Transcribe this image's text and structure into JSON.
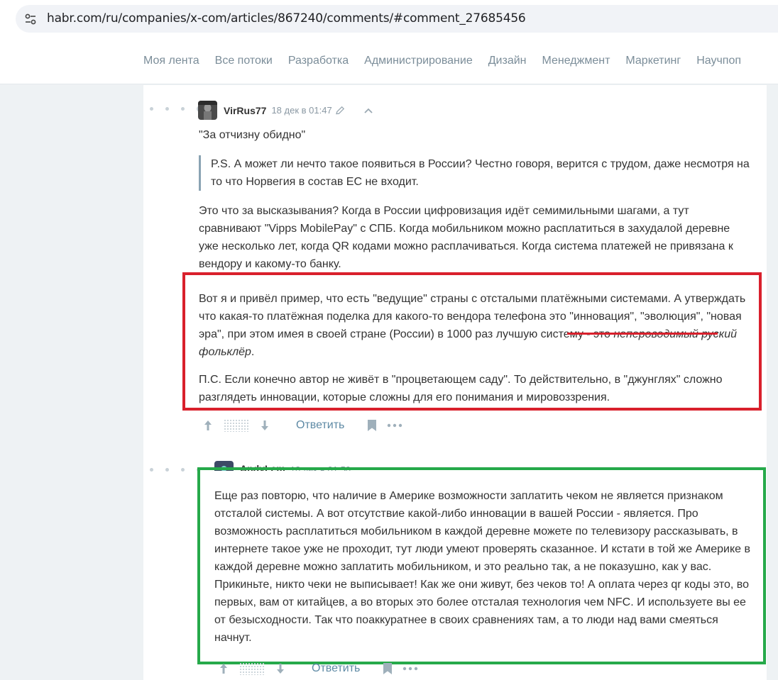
{
  "browser": {
    "url": "habr.com/ru/companies/x-com/articles/867240/comments/#comment_27685456"
  },
  "nav": {
    "items": [
      "Моя лента",
      "Все потоки",
      "Разработка",
      "Администрирование",
      "Дизайн",
      "Менеджмент",
      "Маркетинг",
      "Научпоп"
    ]
  },
  "comments": [
    {
      "author": "VirRus77",
      "date": "18 дек в 01:47",
      "intro": "\"За отчизну обидно\"",
      "quote": "P.S. А может ли нечто такое появиться в России? Честно говоря, верится с трудом, даже несмотря на то что Норвегия в состав ЕС не входит.",
      "p1": "Это что за высказывания? Когда в России цифровизация идёт семимильными шагами, а тут сравнивают \"Vipps MobilePay\" с СПБ. Когда мобильником можно расплатиться в захудалой деревне уже несколько лет, когда QR кодами можно расплачиваться. Когда система платежей не привязана к вендору и какому-то банку.",
      "p2_a": "Вот я и привёл пример, что есть \"ведущие\" страны с отсталыми платёжными системами. А утверждать что какая-то платёжная поделка для какого-то вендора телефона это \"инновация\", \"эволюция\", \"новая эра\", при этом имея в своей стране (России) в 1000 раз лучшую систему - это ",
      "p2_em": "непероводимый руский фольклёр",
      "p2_end": ".",
      "p3": "П.С. Если конечно автор не живёт в \"процветающем саду\". То действительно, в \"джунглях\" сложно разглядеть инновации, которые сложны для его понимания и мировоззрения.",
      "reply_label": "Ответить"
    },
    {
      "author": "AndyLem",
      "date": "18 дек в 01:50",
      "text": "Еще раз повторю, что наличие в Америке возможности заплатить чеком не является признаком отсталой системы. А вот отсутствие какой-либо инновации в вашей России - является. Про возможность расплатиться мобильником в каждой деревне можете по телевизору рассказывать, в интернете такое уже не проходит, тут люди умеют проверять сказанное. И кстати в той же Америке в каждой деревне можно заплатить мобильником, и это реально так, а не показушно, как у вас. Прикиньте, никто чеки не выписывает! Как же они живут, без чеков то! А оплата через qr коды это, во первых, вам от китайцев, а во вторых это более отсталая технология чем NFC. И используете вы ее от безысходности. Так что поаккуратнее в своих сравнениях там, а то люди над вами смеяться начнут.",
      "reply_label": "Ответить"
    }
  ],
  "colors": {
    "highlight_red": "#d9202c",
    "highlight_green": "#26a94a",
    "link": "#5e8aa5"
  }
}
